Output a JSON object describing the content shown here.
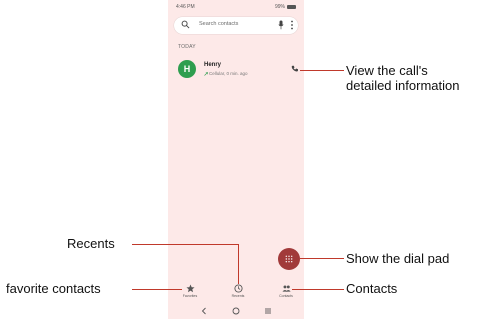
{
  "status_bar": {
    "time": "4:46 PM",
    "battery": "99%"
  },
  "search": {
    "placeholder": "Search contacts",
    "icon": "search-icon"
  },
  "recents": {
    "section_label": "TODAY",
    "items": [
      {
        "initial": "H",
        "name": "Henry",
        "detail": "Cellular, 0 min. ago",
        "avatar_color": "#2e9e4f"
      }
    ]
  },
  "bottom_nav": {
    "items": [
      {
        "label": "Favorites",
        "icon": "star-icon"
      },
      {
        "label": "Recents",
        "icon": "clock-icon"
      },
      {
        "label": "Contacts",
        "icon": "people-icon"
      }
    ]
  },
  "fab": {
    "icon": "dialpad-icon",
    "color": "#a13a3a"
  },
  "annotations": {
    "call_detail": "View the call's detailed information",
    "recents": "Recents",
    "dial_pad": "Show the dial pad",
    "favorites": "favorite contacts",
    "contacts": "Contacts"
  },
  "colors": {
    "screen_bg": "#fde9e8",
    "callout_line": "#c0392b"
  }
}
